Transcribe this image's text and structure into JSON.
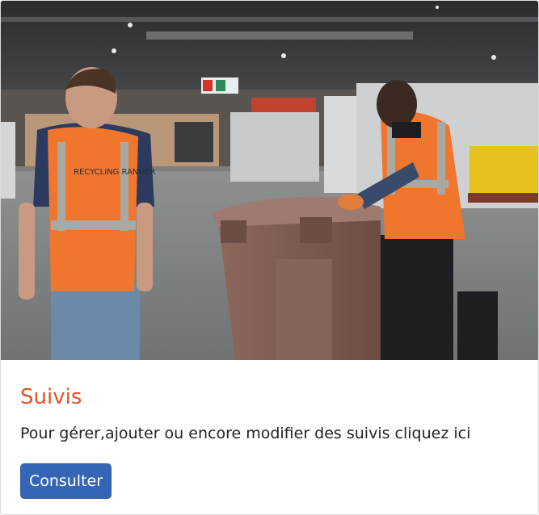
{
  "card": {
    "image_alt": "Recycling rangers pushing a wheelie bin in a warehouse",
    "vest_text": "RECYCLING RANGER",
    "title": "Suivis",
    "description": "Pour gérer,ajouter ou encore modifier des suivis cliquez ici",
    "button_label": "Consulter"
  },
  "colors": {
    "title": "#e0542b",
    "button_bg": "#3566b6",
    "vest": "#f0762e",
    "bin": "#7e5a50"
  }
}
